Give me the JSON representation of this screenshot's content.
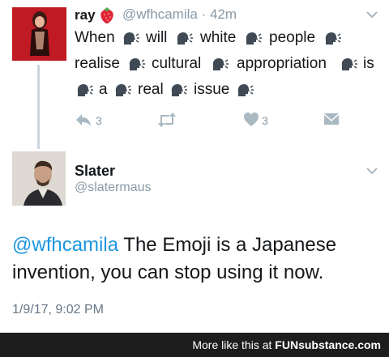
{
  "reply": {
    "name": "ray",
    "handle": "@wfhcamila",
    "time": "· 42m",
    "lines": [
      [
        "When",
        "will",
        "white",
        "people"
      ],
      [
        "realise",
        "cultural",
        "appropriation",
        "is"
      ],
      [
        "a",
        "real",
        "issue"
      ]
    ],
    "reply_count": "3",
    "like_count": "3"
  },
  "tweet": {
    "name": "Slater",
    "handle": "@slatermaus",
    "mention": "@wfhcamila",
    "text_line1": " The Emoji is a Japanese",
    "text_line2": "invention, you can stop using it now.",
    "timestamp": "1/9/17, 9:02 PM"
  },
  "footer": {
    "prefix": "More like this at ",
    "brand": "FUNsubstance.com"
  },
  "icons": {
    "emoji": "speaking-head-emoji",
    "strawberry": "strawberry-emoji",
    "reply": "reply-icon",
    "retweet": "retweet-icon",
    "like": "heart-icon",
    "dm": "envelope-icon",
    "caret": "chevron-down-icon"
  },
  "colors": {
    "link": "#1b95e0",
    "muted": "#8899a6",
    "footer_bg": "#1d1d1d"
  }
}
